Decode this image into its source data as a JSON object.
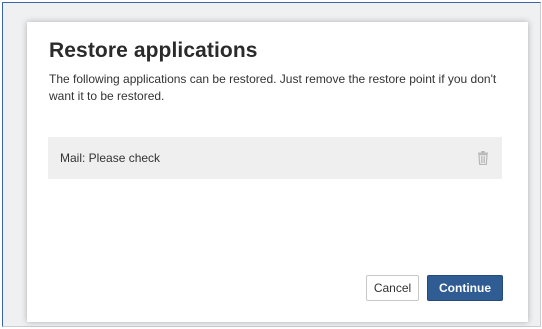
{
  "dialog": {
    "title": "Restore applications",
    "description": "The following applications can be restored. Just remove the restore point if you don't want it to be restored.",
    "items": [
      {
        "label": "Mail: Please check",
        "action_icon": "trash-icon"
      }
    ],
    "buttons": {
      "cancel_label": "Cancel",
      "continue_label": "Continue"
    }
  },
  "colors": {
    "primary_button": "#2e5c93",
    "list_item_background": "#efefef",
    "frame_accent": "#3c64a8"
  }
}
